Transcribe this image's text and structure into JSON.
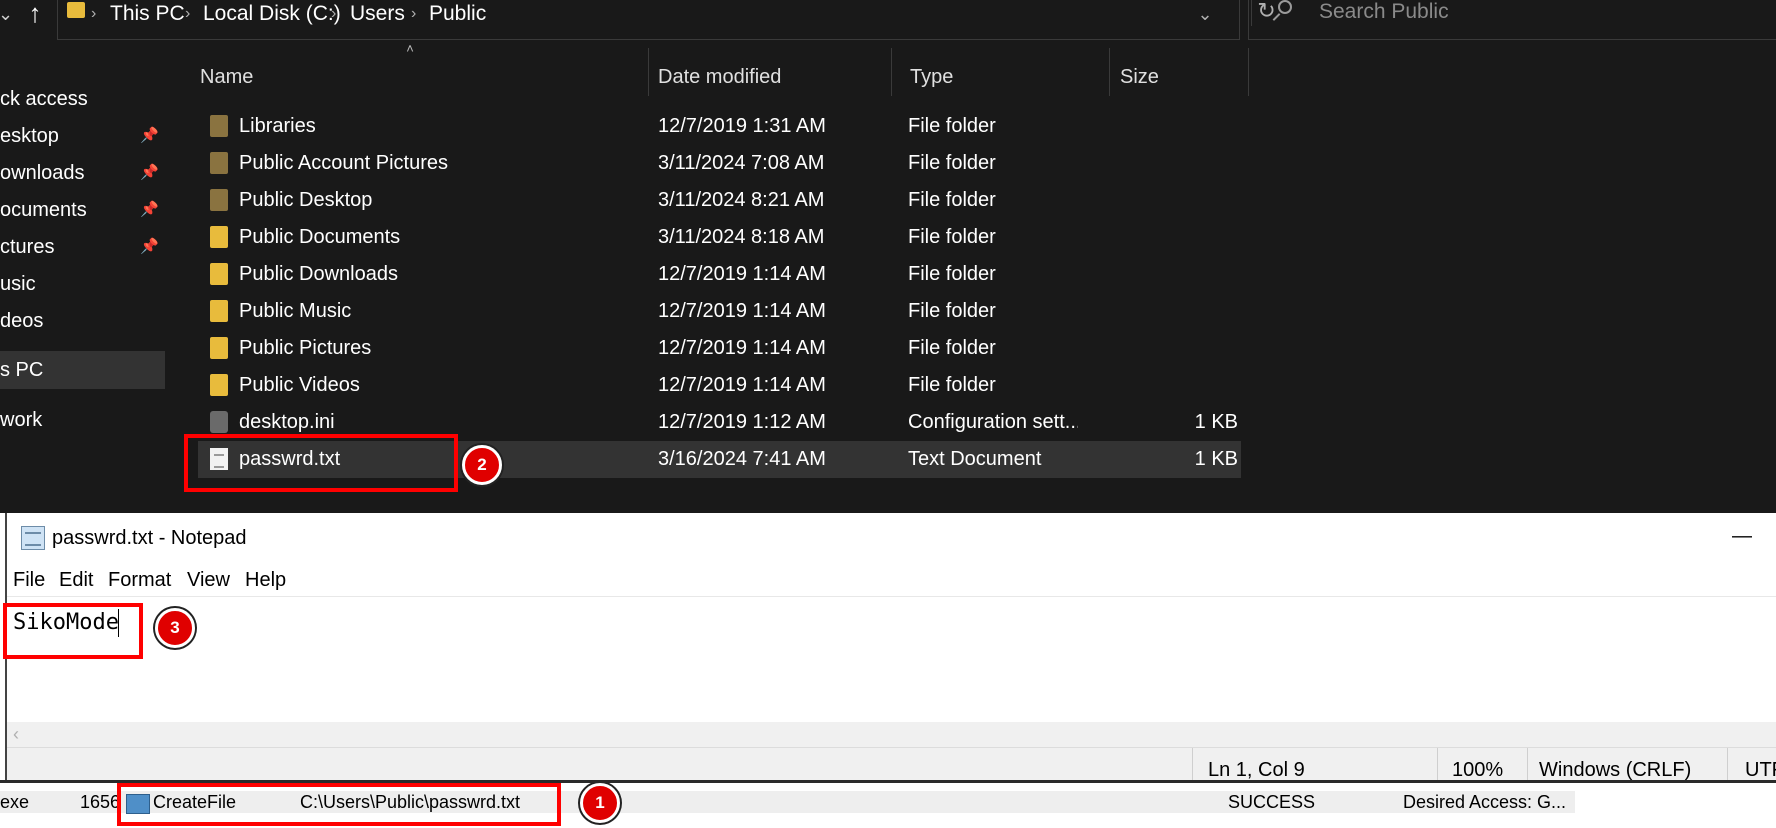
{
  "explorer": {
    "breadcrumb": [
      "This PC",
      "Local Disk (C:)",
      "Users",
      "Public"
    ],
    "search_placeholder": "Search Public",
    "nav_items": [
      {
        "label": "ck access",
        "pinned": false,
        "selected": false
      },
      {
        "label": "esktop",
        "pinned": true,
        "selected": false
      },
      {
        "label": "ownloads",
        "pinned": true,
        "selected": false
      },
      {
        "label": "ocuments",
        "pinned": true,
        "selected": false
      },
      {
        "label": "ctures",
        "pinned": true,
        "selected": false
      },
      {
        "label": "usic",
        "pinned": false,
        "selected": false
      },
      {
        "label": "deos",
        "pinned": false,
        "selected": false
      },
      {
        "label": "s PC",
        "pinned": false,
        "selected": true
      },
      {
        "label": "work",
        "pinned": false,
        "selected": false
      }
    ],
    "columns": [
      "Name",
      "Date modified",
      "Type",
      "Size"
    ],
    "files": [
      {
        "name": "Libraries",
        "date": "12/7/2019 1:31 AM",
        "type": "File folder",
        "size": "",
        "icon": "folder-icon"
      },
      {
        "name": "Public Account Pictures",
        "date": "3/11/2024 7:08 AM",
        "type": "File folder",
        "size": "",
        "icon": "folder-icon"
      },
      {
        "name": "Public Desktop",
        "date": "3/11/2024 8:21 AM",
        "type": "File folder",
        "size": "",
        "icon": "folder-icon"
      },
      {
        "name": "Public Documents",
        "date": "3/11/2024 8:18 AM",
        "type": "File folder",
        "size": "",
        "icon": "folder-icon"
      },
      {
        "name": "Public Downloads",
        "date": "12/7/2019 1:14 AM",
        "type": "File folder",
        "size": "",
        "icon": "folder-icon"
      },
      {
        "name": "Public Music",
        "date": "12/7/2019 1:14 AM",
        "type": "File folder",
        "size": "",
        "icon": "folder-icon"
      },
      {
        "name": "Public Pictures",
        "date": "12/7/2019 1:14 AM",
        "type": "File folder",
        "size": "",
        "icon": "folder-icon"
      },
      {
        "name": "Public Videos",
        "date": "12/7/2019 1:14 AM",
        "type": "File folder",
        "size": "",
        "icon": "folder-icon"
      },
      {
        "name": "desktop.ini",
        "date": "12/7/2019 1:12 AM",
        "type": "Configuration sett...",
        "size": "1 KB",
        "icon": "settings-file-icon"
      },
      {
        "name": "passwrd.txt",
        "date": "3/16/2024 7:41 AM",
        "type": "Text Document",
        "size": "1 KB",
        "icon": "text-file-icon"
      }
    ]
  },
  "notepad": {
    "title": "passwrd.txt - Notepad",
    "menu": [
      "File",
      "Edit",
      "Format",
      "View",
      "Help"
    ],
    "content": "SikoMode",
    "status": {
      "position": "Ln 1, Col 9",
      "zoom": "100%",
      "line_ending": "Windows (CRLF)",
      "encoding": "UTF"
    }
  },
  "procmon": {
    "process": "exe",
    "pid": "1656",
    "operation": "CreateFile",
    "path": "C:\\Users\\Public\\passwrd.txt",
    "result": "SUCCESS",
    "detail": "Desired Access: G..."
  },
  "annotations": {
    "colors": {
      "highlight": "#ff0000",
      "badge": "#e00000"
    },
    "badges": [
      "1",
      "2",
      "3"
    ]
  }
}
